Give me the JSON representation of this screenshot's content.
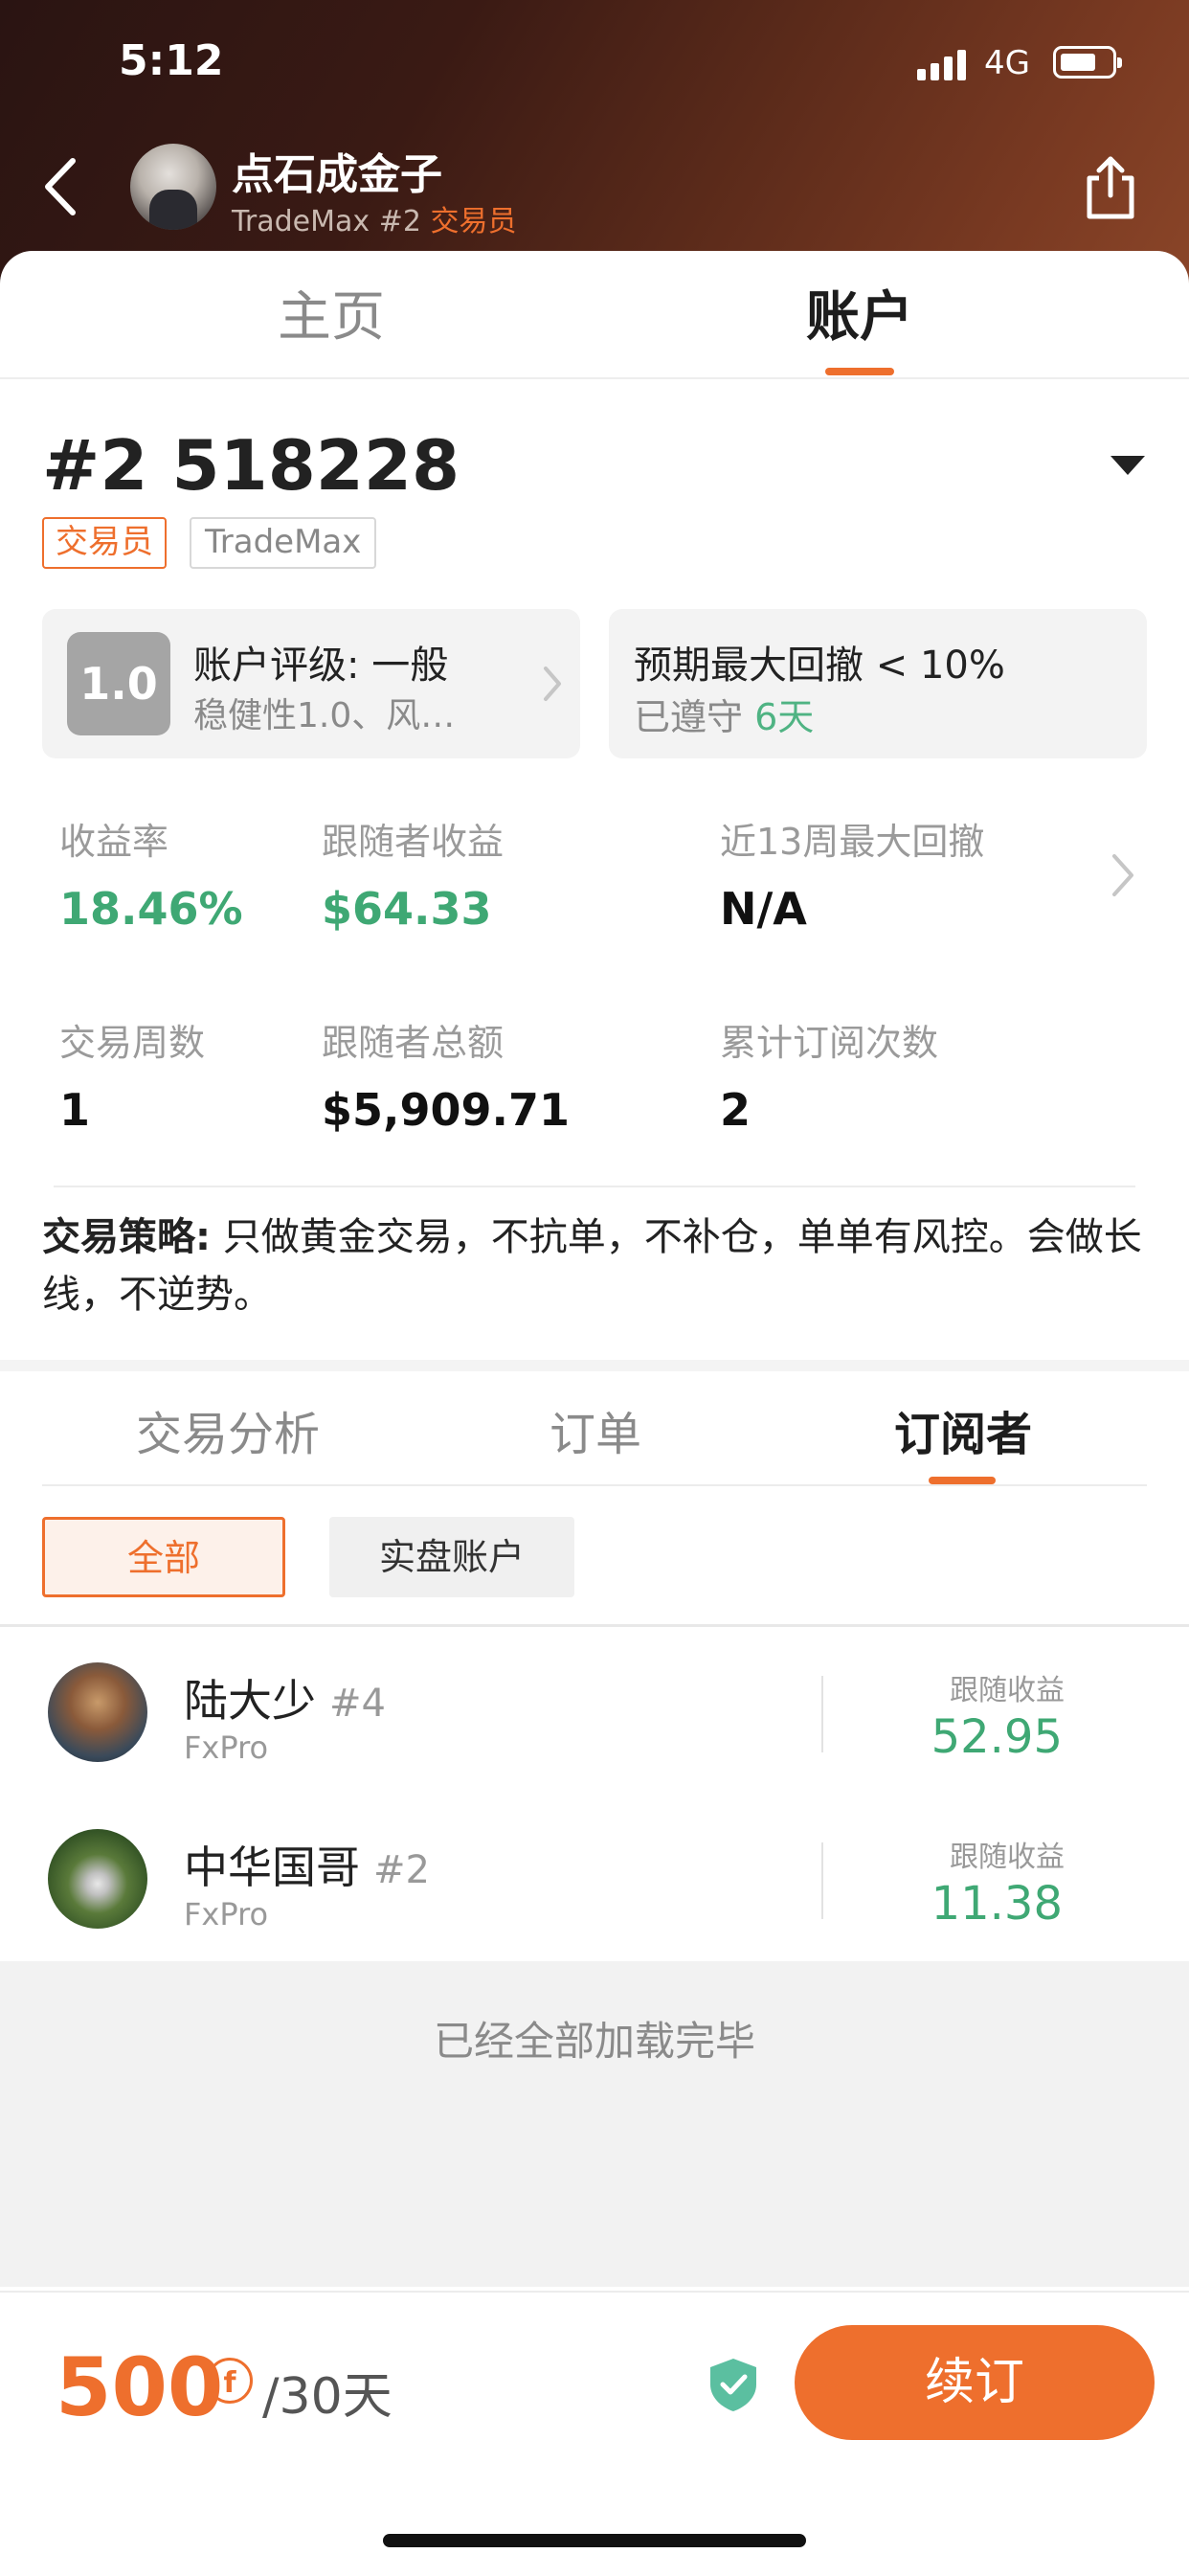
{
  "status_bar": {
    "time": "5:12",
    "network": "4G"
  },
  "header": {
    "trader_name": "点石成金子",
    "broker_rank": "TradeMax #2 ",
    "role": "交易员"
  },
  "tabs": [
    {
      "label": "主页"
    },
    {
      "label": "账户"
    }
  ],
  "account": {
    "title": "#2 518228",
    "tag_role": "交易员",
    "tag_broker": "TradeMax"
  },
  "rating_box": {
    "badge": "1.0",
    "title": "账户评级: 一般",
    "subtitle": "稳健性1.0、风…"
  },
  "drawdown_box": {
    "title": "预期最大回撤 < 10%",
    "sub_prefix": "已遵守 ",
    "sub_days": "6天"
  },
  "stats": [
    {
      "label": "收益率",
      "value": "18.46%"
    },
    {
      "label": "跟随者收益",
      "value": "$64.33"
    },
    {
      "label": "近13周最大回撤",
      "value": "N/A"
    },
    {
      "label": "交易周数",
      "value": "1"
    },
    {
      "label": "跟随者总额",
      "value": "$5,909.71"
    },
    {
      "label": "累计订阅次数",
      "value": "2"
    }
  ],
  "strategy": {
    "label": "交易策略:",
    "text": " 只做黄金交易，不抗单，不补仓，单单有风控。会做长线，不逆势。"
  },
  "subtabs": [
    {
      "label": "交易分析"
    },
    {
      "label": "订单"
    },
    {
      "label": "订阅者"
    }
  ],
  "filters": [
    {
      "label": "全部"
    },
    {
      "label": "实盘账户"
    }
  ],
  "subscribers": [
    {
      "name": "陆大少",
      "rank": "#4",
      "broker": "FxPro",
      "gain_label": "跟随收益",
      "gain": "52.95"
    },
    {
      "name": "中华国哥",
      "rank": "#2",
      "broker": "FxPro",
      "gain_label": "跟随收益",
      "gain": "11.38"
    }
  ],
  "loaded_text": "已经全部加载完毕",
  "bottom": {
    "price": "500",
    "coin_symbol": "f",
    "period": "/30天",
    "renew_label": "续订"
  },
  "colors": {
    "accent": "#ee6f2d",
    "positive": "#3fa874"
  }
}
